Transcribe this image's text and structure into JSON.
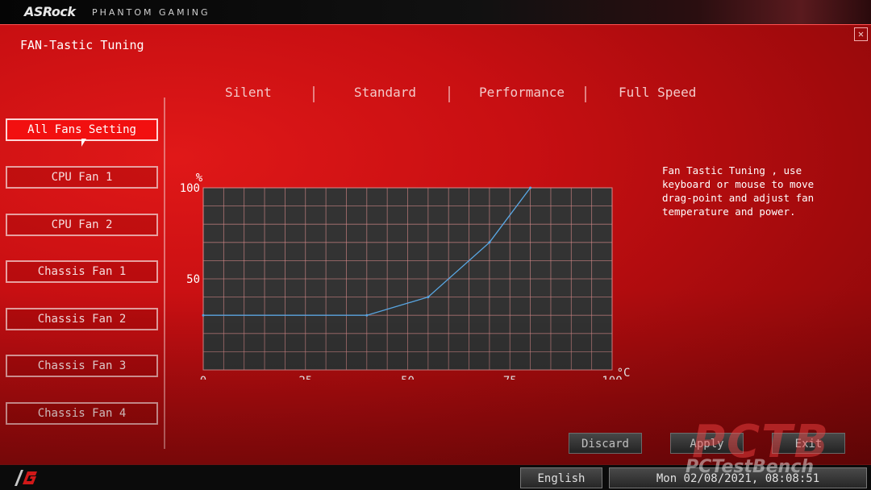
{
  "header": {
    "brand": "ASRock",
    "sub_brand": "PHANTOM GAMING"
  },
  "page": {
    "title": "FAN-Tastic Tuning",
    "close_icon": "close-icon"
  },
  "presets": [
    {
      "label": "Silent"
    },
    {
      "label": "Standard"
    },
    {
      "label": "Performance"
    },
    {
      "label": "Full Speed"
    }
  ],
  "sidebar": {
    "items": [
      {
        "label": "All Fans Setting",
        "active": true
      },
      {
        "label": "CPU Fan 1"
      },
      {
        "label": "CPU Fan 2"
      },
      {
        "label": "Chassis Fan 1"
      },
      {
        "label": "Chassis Fan 2"
      },
      {
        "label": "Chassis Fan 3"
      },
      {
        "label": "Chassis Fan 4"
      }
    ]
  },
  "hint": {
    "text": "Fan Tastic Tuning , use keyboard or mouse to move drag-point and adjust fan temperature and power."
  },
  "chart_data": {
    "type": "line",
    "xlabel": "°C",
    "ylabel": "%",
    "xlim": [
      0,
      100
    ],
    "ylim": [
      0,
      100
    ],
    "x_ticks": [
      "0",
      "25",
      "50",
      "75",
      "100"
    ],
    "y_ticks": [
      "50",
      "100"
    ],
    "grid": true,
    "series": [
      {
        "x": [
          0,
          40,
          55,
          70,
          80
        ],
        "y": [
          30,
          30,
          40,
          70,
          100
        ]
      }
    ],
    "colors": {
      "line": "#5aa9e6",
      "grid": "#d88a8a",
      "background": "#333333"
    }
  },
  "actions": {
    "discard": "Discard",
    "apply": "Apply",
    "exit": "Exit"
  },
  "footer": {
    "language": "English",
    "datetime": "Mon 02/08/2021, 08:08:51"
  },
  "watermark": {
    "logo": "PCTB",
    "text": "PCTestBench"
  }
}
